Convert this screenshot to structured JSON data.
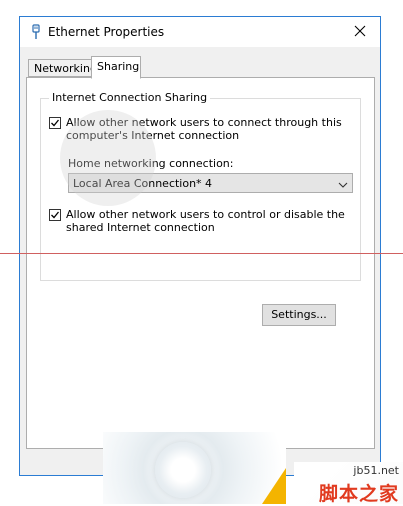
{
  "window": {
    "title": "Ethernet Properties",
    "accent_color": "#2b7cd3",
    "title_icon": "ethernet-plug-icon",
    "close_icon": "close-icon"
  },
  "tabs": [
    {
      "label": "Networking",
      "selected": false
    },
    {
      "label": "Sharing",
      "selected": true
    }
  ],
  "sharing": {
    "group_title": "Internet Connection Sharing",
    "allow_connect": {
      "checked": true,
      "label_line1": "Allow other network users to connect through this",
      "label_line2": "computer's Internet connection"
    },
    "home_network_label": "Home networking connection:",
    "home_network_value": "Local Area Connection* 4",
    "allow_control": {
      "checked": true,
      "label_line1": "Allow other network users to control or disable the",
      "label_line2": "shared Internet connection"
    },
    "settings_label": "Settings..."
  },
  "watermark": {
    "url": "jb51.net",
    "name": "脚本之家",
    "brand_color": "#e13a1f"
  }
}
